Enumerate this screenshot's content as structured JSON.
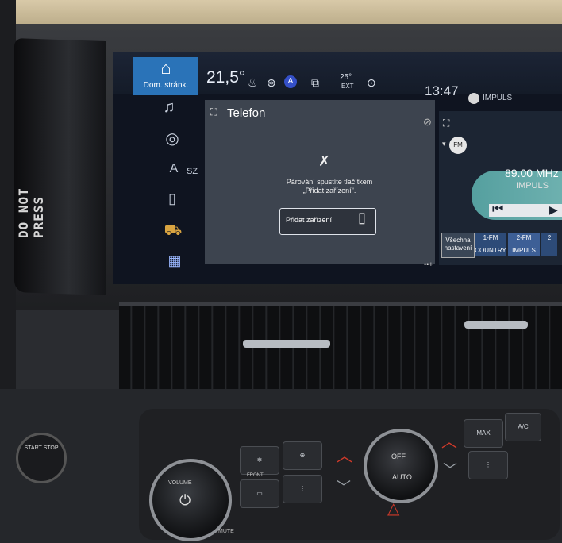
{
  "colors": {
    "home_tile": "#2a73b8",
    "screen_bg": "#0f1420",
    "phone_panel": "#3d444f",
    "radio_accent": "#5fb5b2",
    "temp_up_arrow": "#d03a2a"
  },
  "dashboard": {
    "side_label": "DO NOT PRESS"
  },
  "status_bar": {
    "home_label": "Dom. stránk.",
    "temperature": "21,5°",
    "ext_temp": "25°",
    "ext_label": "EXT",
    "time": "13:47",
    "station": "IMPULS"
  },
  "sidebar": {
    "items": [
      {
        "icon": "music-note-icon"
      },
      {
        "icon": "speedometer-icon"
      },
      {
        "icon": "navigation-arrow-icon",
        "label": "SZ"
      },
      {
        "icon": "phone-icon"
      },
      {
        "icon": "car-icon"
      },
      {
        "icon": "apps-grid-icon"
      }
    ]
  },
  "phone": {
    "title": "Telefon",
    "message_line1": "Párování spustíte tlačítkem",
    "message_line2": "„Přidat zařízení\".",
    "add_button": "Přidat zařízení"
  },
  "radio": {
    "band": "FM",
    "frequency": "89.00 MHz",
    "station": "IMPULS",
    "presets": [
      {
        "line1": "Všechna",
        "line2": "nastavení"
      },
      {
        "line1": "1-FM",
        "line2": "COUNTRY"
      },
      {
        "line1": "2-FM",
        "line2": "IMPULS"
      },
      {
        "line1": "2",
        "line2": ""
      }
    ]
  },
  "controls": {
    "start_stop": "START STOP",
    "volume_label": "VOLUME",
    "fan_off": "OFF",
    "auto": "AUTO",
    "front": "FRONT",
    "mute": "MUTE",
    "max": "MAX",
    "ac": "A/C"
  }
}
